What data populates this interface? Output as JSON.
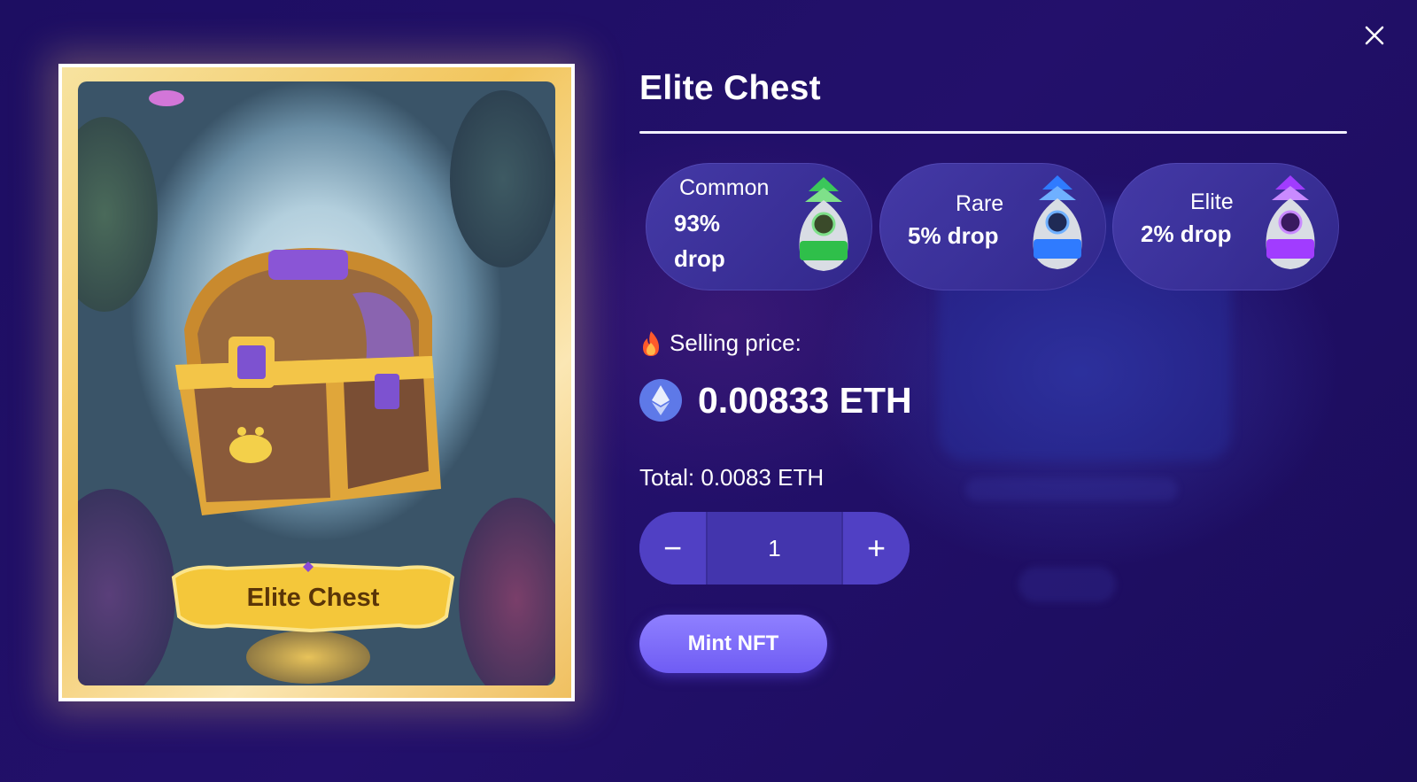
{
  "modal": {
    "title": "Elite Chest",
    "close_icon": "close-icon"
  },
  "card": {
    "banner_text": "Elite Chest"
  },
  "drops": [
    {
      "name": "Common",
      "rate": "93% drop",
      "color": "#2fbf4a",
      "icon": "common-egg-icon"
    },
    {
      "name": "Rare",
      "rate": "5% drop",
      "color": "#2f7bff",
      "icon": "rare-egg-icon"
    },
    {
      "name": "Elite",
      "rate": "2% drop",
      "color": "#a13cff",
      "icon": "elite-egg-icon"
    }
  ],
  "pricing": {
    "selling_label": "Selling price:",
    "price": "0.00833 ETH",
    "total": "Total: 0.0083 ETH",
    "quantity": "1",
    "minus_label": "−",
    "plus_label": "+"
  },
  "actions": {
    "mint_label": "Mint NFT"
  },
  "colors": {
    "background": "#1c0f5e",
    "accent": "#7b68ff",
    "card_gold": "#f2c55c"
  }
}
